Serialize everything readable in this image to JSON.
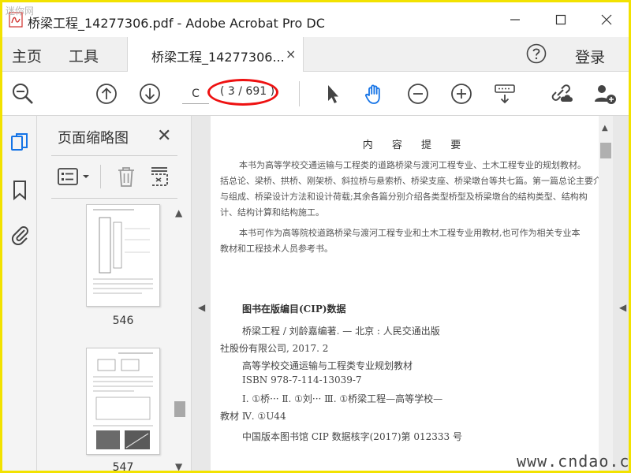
{
  "window": {
    "title": "桥梁工程_14277306.pdf - Adobe Acrobat Pro DC",
    "corner_watermark": "迷你网"
  },
  "tabs": {
    "home": "主页",
    "tools": "工具",
    "document": "桥梁工程_14277306...",
    "close": "×",
    "login": "登录"
  },
  "toolbar": {
    "page_current": "C",
    "page_count": "( 3 / 691 )"
  },
  "thumbnail_panel": {
    "title": "页面缩略图",
    "close": "✕",
    "pages": [
      {
        "number": "546"
      },
      {
        "number": "547"
      }
    ]
  },
  "document": {
    "summary_title": "内 容 提 要",
    "summary_lines": [
      "本书为高等学校交通运输与工程类的道路桥梁与渡河工程专业、土木工程专业的规划教材。",
      "括总论、梁桥、拱桥、刚架桥、斜拉桥与悬索桥、桥梁支座、桥梁墩台等共七篇。第一篇总论主要介",
      "与组成、桥梁设计方法和设计荷载;其余各篇分别介绍各类型桥型及桥梁墩台的结构类型、结构构",
      "计、结构计算和结构施工。",
      "本书可作为高等院校道路桥梁与渡河工程专业和土木工程专业用教材,也可作为相关专业本",
      "教材和工程技术人员参考书。"
    ],
    "cip_title": "图书在版编目(CIP)数据",
    "cip_lines": [
      "桥梁工程 / 刘龄嘉编著. — 北京 : 人民交通出版",
      "社股份有限公司, 2017. 2",
      "高等学校交通运输与工程类专业规划教材",
      "ISBN 978-7-114-13039-7",
      "Ⅰ. ①桥··· Ⅱ. ①刘··· Ⅲ. ①桥梁工程—高等学校—",
      "教材 Ⅳ. ①U44",
      "中国版本图书馆 CIP 数据核字(2017)第 012333 号"
    ]
  },
  "site_watermark": "www.cndao.com",
  "colors": {
    "frame": "#f2e200",
    "annotation": "#e11111",
    "accent": "#1473e6"
  }
}
